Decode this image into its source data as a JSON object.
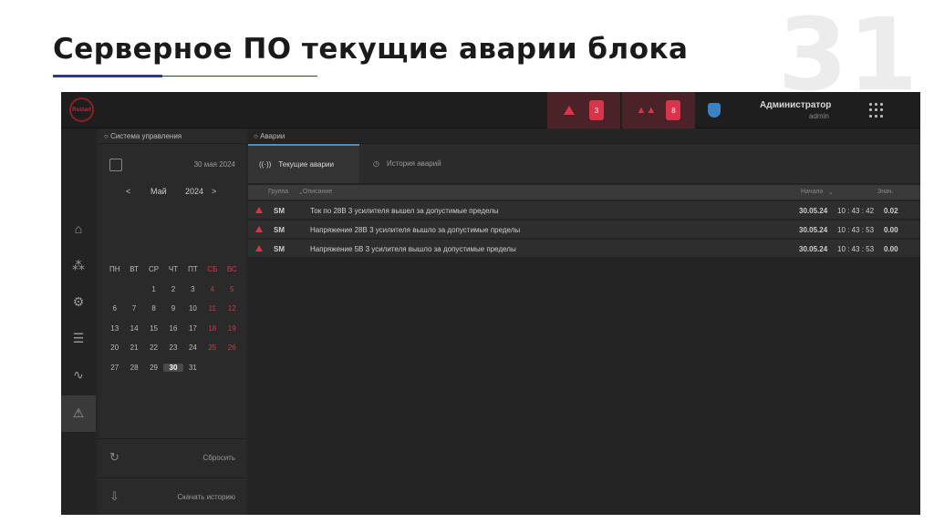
{
  "slide": {
    "title": "Серверное ПО текущие аварии блока",
    "page_number": "31"
  },
  "topbar": {
    "logo_text": "Rsstart",
    "alarm_critical_count": "3",
    "alarm_warning_count": "8",
    "user_name": "Администратор",
    "user_role": "admin",
    "colors": {
      "alarm": "#d8354a",
      "accent": "#4a90c8"
    }
  },
  "leftnav": {
    "items": [
      "home-icon",
      "network-icon",
      "settings-icon",
      "list-icon",
      "signal-icon",
      "warning-icon"
    ],
    "active": "warning-icon"
  },
  "sidepanel": {
    "header": "Система управления",
    "date": "30 мая 2024",
    "month": "Май",
    "year": "2024",
    "weekdays": [
      "ПН",
      "ВТ",
      "СР",
      "ЧТ",
      "ПТ",
      "СБ",
      "ВС"
    ],
    "weeks": [
      [
        "",
        "",
        "1",
        "2",
        "3",
        "4",
        "5"
      ],
      [
        "6",
        "7",
        "8",
        "9",
        "10",
        "11",
        "12"
      ],
      [
        "13",
        "14",
        "15",
        "16",
        "17",
        "18",
        "19"
      ],
      [
        "20",
        "21",
        "22",
        "23",
        "24",
        "25",
        "26"
      ],
      [
        "27",
        "28",
        "29",
        "30",
        "31",
        "",
        ""
      ]
    ],
    "selected_day": "30",
    "reset_label": "Сбросить",
    "download_label": "Скачать историю"
  },
  "main": {
    "header": "Аварии",
    "tabs": [
      {
        "label": "Текущие аварии",
        "active": true
      },
      {
        "label": "История аварий",
        "active": false
      }
    ],
    "columns": {
      "group": "Группа",
      "description": "Описание",
      "start": "Начало",
      "value": "Знач."
    },
    "rows": [
      {
        "group": "SM",
        "description": "Ток по 28В 3 усилителя вышел за допустимые пределы",
        "date": "30.05.24",
        "time": "10 : 43 : 42",
        "value": "0.02"
      },
      {
        "group": "SM",
        "description": "Напряжение 28В 3 усилителя вышло за допустимые пределы",
        "date": "30.05.24",
        "time": "10 : 43 : 53",
        "value": "0.00"
      },
      {
        "group": "SM",
        "description": "Напряжение 5В 3 усилителя вышло за допустимые пределы",
        "date": "30.05.24",
        "time": "10 : 43 : 53",
        "value": "0.00"
      }
    ]
  }
}
